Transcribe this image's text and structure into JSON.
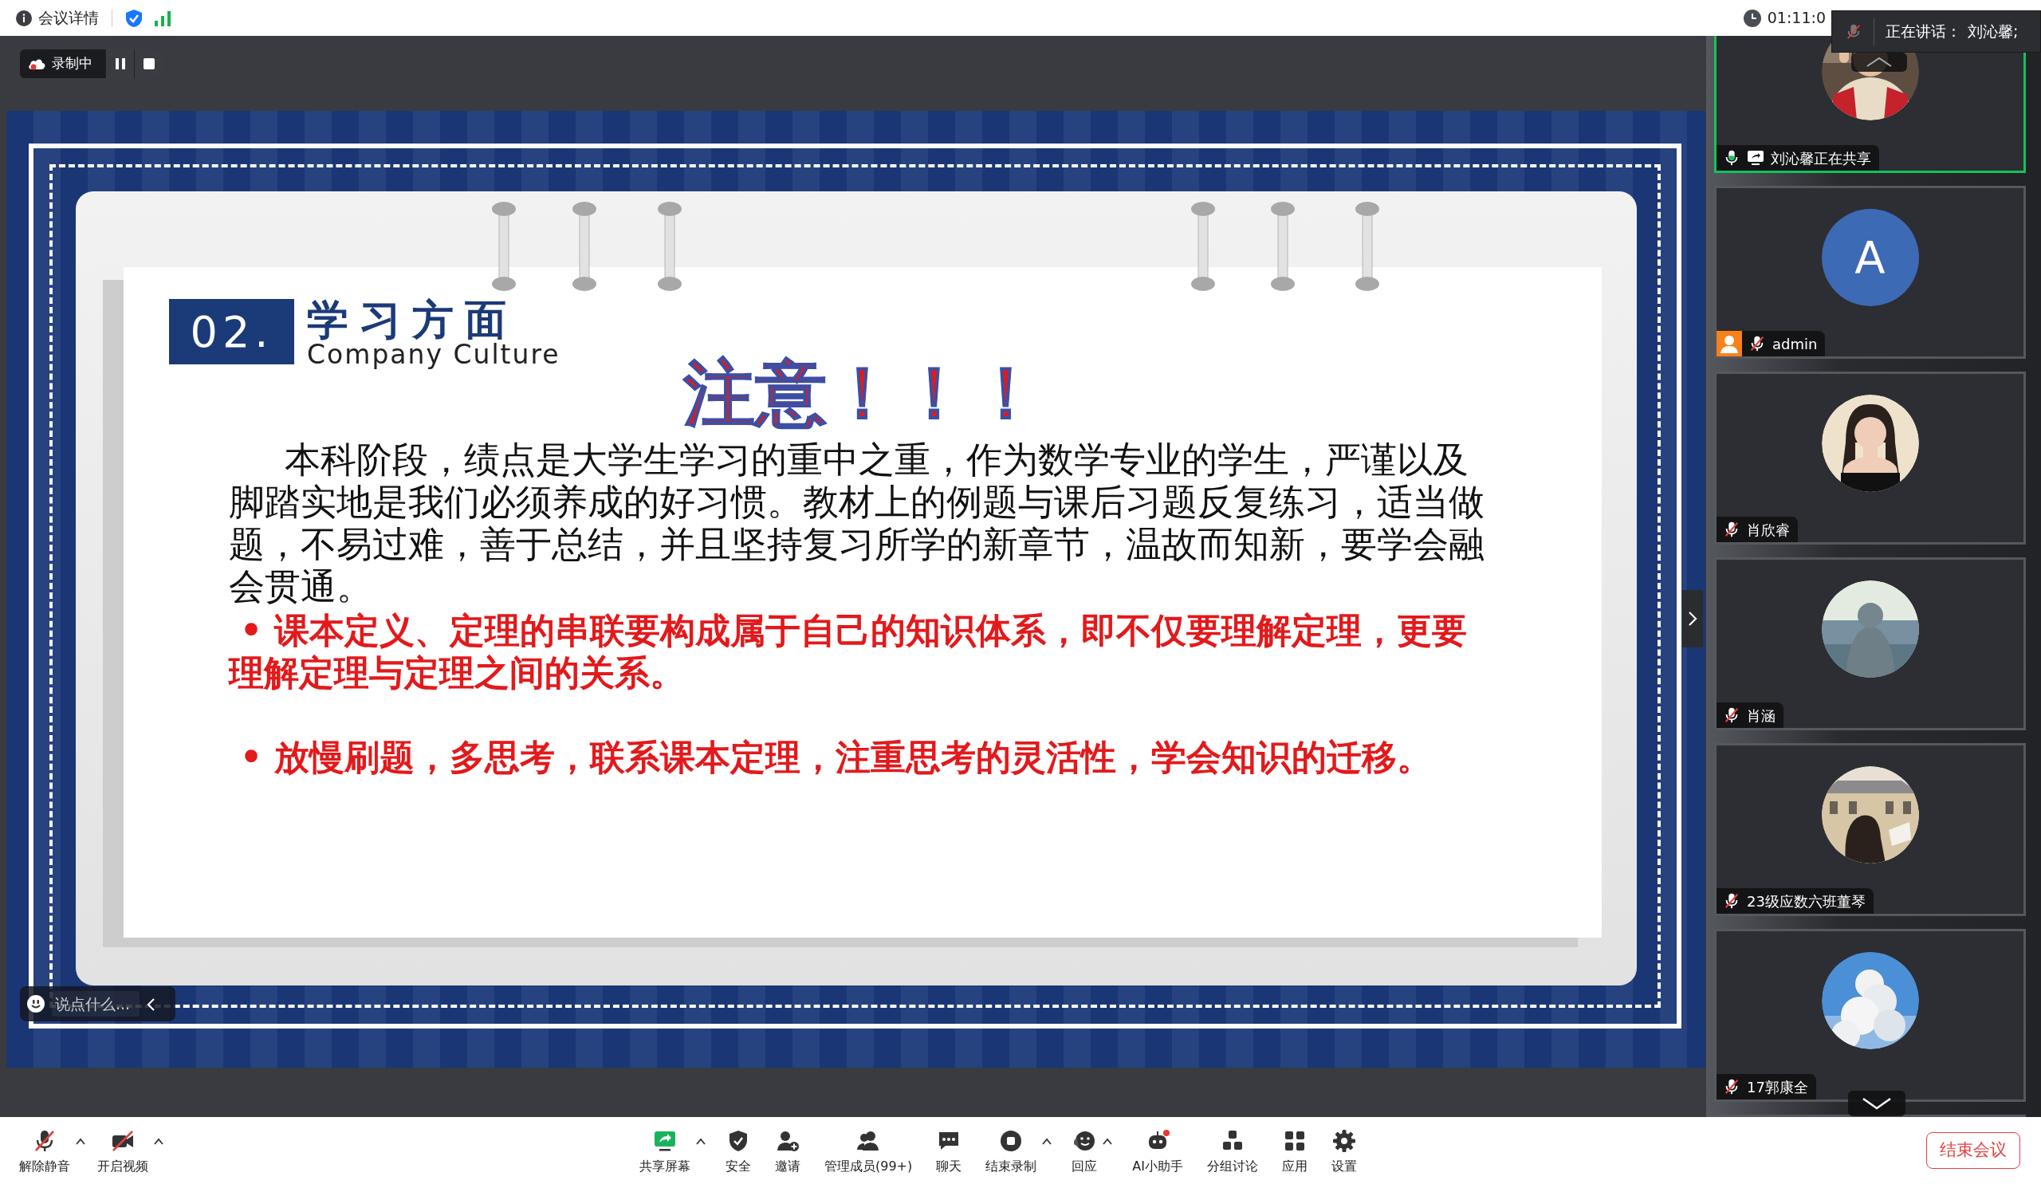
{
  "top_bar": {
    "meeting_details": "会议详情",
    "elapsed_time": "01:11:0"
  },
  "speaking_banner": {
    "label": "正在讲话：",
    "name": "刘沁馨;"
  },
  "recording": {
    "label": "录制中"
  },
  "slide": {
    "number": "02.",
    "title": "学习方面",
    "subtitle": "Company Culture",
    "heading": "注意！！！",
    "paragraph": "本科阶段，绩点是大学生学习的重中之重，作为数学专业的学生，严谨以及脚踏实地是我们必须养成的好习惯。教材上的例题与课后习题反复练习，适当做题，不易过难，善于总结，并且坚持复习所学的新章节，温故而知新，要学会融会贯通。",
    "bullets": [
      "• 课本定义、定理的串联要构成属于自己的知识体系，即不仅要理解定理，更要理解定理与定理之间的关系。",
      "• 放慢刷题，多思考，联系课本定理，注重思考的灵活性，学会知识的迁移。"
    ]
  },
  "chat_input": {
    "placeholder": "说点什么..."
  },
  "participants": [
    {
      "name": "刘沁馨正在共享",
      "host": false,
      "muted": false,
      "sharing": true,
      "active": true
    },
    {
      "name": "admin",
      "avatar": {
        "kind": "initial",
        "text": "A"
      },
      "host": true,
      "muted": true,
      "sharing": false,
      "active": false
    },
    {
      "name": "肖欣睿",
      "host": false,
      "muted": true,
      "sharing": false,
      "active": false
    },
    {
      "name": "肖涵",
      "host": false,
      "muted": true,
      "sharing": false,
      "active": false
    },
    {
      "name": "23级应数六班董琴",
      "host": false,
      "muted": true,
      "sharing": false,
      "active": false
    },
    {
      "name": "17郭康全",
      "host": false,
      "muted": true,
      "sharing": false,
      "active": false
    }
  ],
  "toolbar": {
    "left": [
      {
        "label": "解除静音",
        "menu": true
      },
      {
        "label": "开启视频",
        "menu": true
      }
    ],
    "center": [
      {
        "label": "共享屏幕",
        "menu": true
      },
      {
        "label": "安全",
        "menu": false
      },
      {
        "label": "邀请",
        "menu": false
      },
      {
        "label": "管理成员(99+)",
        "menu": false
      },
      {
        "label": "聊天",
        "menu": false
      },
      {
        "label": "结束录制",
        "menu": true
      },
      {
        "label": "回应",
        "menu": true
      },
      {
        "label": "AI小助手",
        "menu": false
      },
      {
        "label": "分组讨论",
        "menu": false
      },
      {
        "label": "应用",
        "menu": false
      },
      {
        "label": "设置",
        "menu": false
      }
    ]
  },
  "end_meeting": "结束会议"
}
